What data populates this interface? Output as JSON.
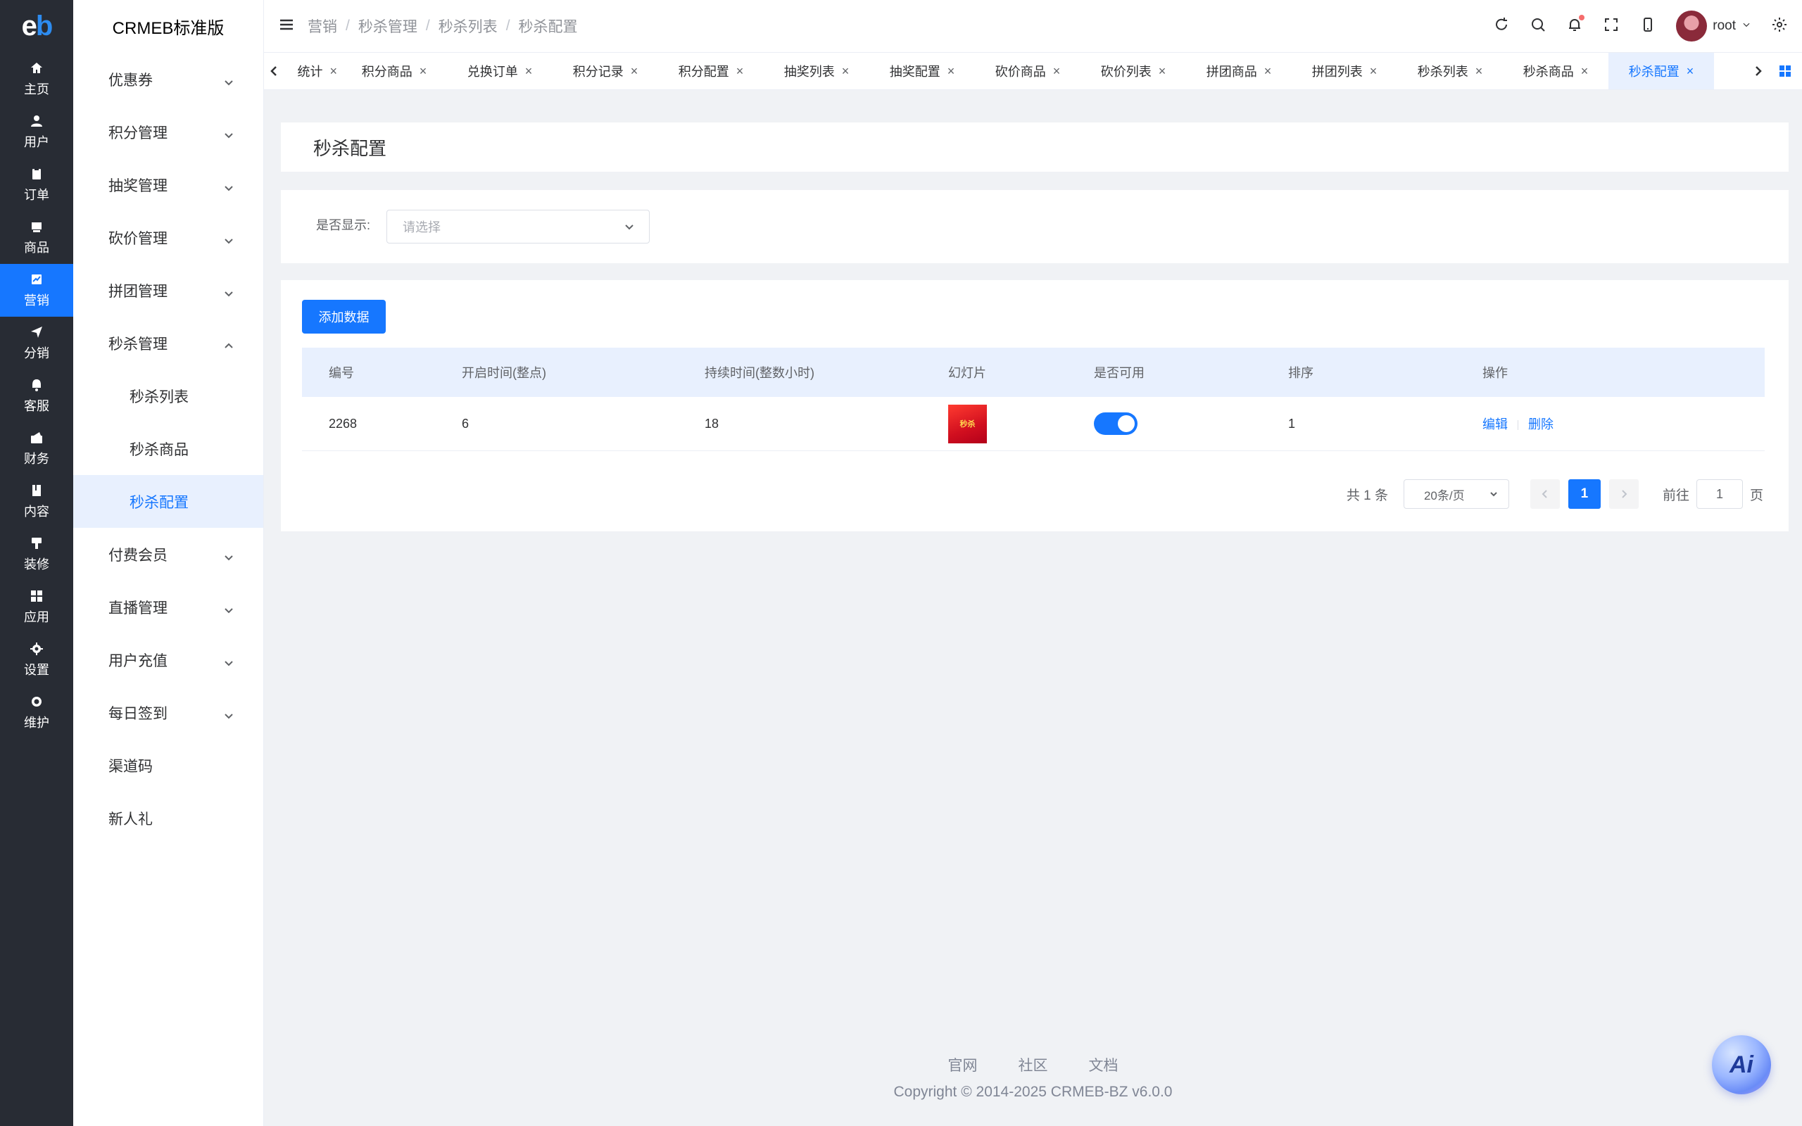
{
  "leftnav": {
    "logo_e": "e",
    "logo_b": "b",
    "items": [
      {
        "label": "主页",
        "icon": "home-icon"
      },
      {
        "label": "用户",
        "icon": "user-icon"
      },
      {
        "label": "订单",
        "icon": "order-icon"
      },
      {
        "label": "商品",
        "icon": "product-icon"
      },
      {
        "label": "营销",
        "icon": "marketing-icon"
      },
      {
        "label": "分销",
        "icon": "distribution-icon"
      },
      {
        "label": "客服",
        "icon": "service-icon"
      },
      {
        "label": "财务",
        "icon": "finance-icon"
      },
      {
        "label": "内容",
        "icon": "content-icon"
      },
      {
        "label": "装修",
        "icon": "decorate-icon"
      },
      {
        "label": "应用",
        "icon": "apps-icon"
      },
      {
        "label": "设置",
        "icon": "settings-icon"
      },
      {
        "label": "维护",
        "icon": "maintenance-icon"
      }
    ]
  },
  "sidebar": {
    "brand": "CRMEB标准版",
    "items": [
      {
        "label": "优惠券"
      },
      {
        "label": "积分管理"
      },
      {
        "label": "抽奖管理"
      },
      {
        "label": "砍价管理"
      },
      {
        "label": "拼团管理"
      },
      {
        "label": "秒杀管理"
      },
      {
        "label": "秒杀列表"
      },
      {
        "label": "秒杀商品"
      },
      {
        "label": "秒杀配置"
      },
      {
        "label": "付费会员"
      },
      {
        "label": "直播管理"
      },
      {
        "label": "用户充值"
      },
      {
        "label": "每日签到"
      },
      {
        "label": "渠道码"
      },
      {
        "label": "新人礼"
      }
    ]
  },
  "header": {
    "breadcrumb": [
      "营销",
      "秒杀管理",
      "秒杀列表",
      "秒杀配置"
    ],
    "breadcrumb_sep": "/",
    "username": "root"
  },
  "tabs": [
    {
      "label": "统计"
    },
    {
      "label": "积分商品"
    },
    {
      "label": "兑换订单"
    },
    {
      "label": "积分记录"
    },
    {
      "label": "积分配置"
    },
    {
      "label": "抽奖列表"
    },
    {
      "label": "抽奖配置"
    },
    {
      "label": "砍价商品"
    },
    {
      "label": "砍价列表"
    },
    {
      "label": "拼团商品"
    },
    {
      "label": "拼团列表"
    },
    {
      "label": "秒杀列表"
    },
    {
      "label": "秒杀商品"
    },
    {
      "label": "秒杀配置"
    }
  ],
  "tab_close": "×",
  "page": {
    "title": "秒杀配置",
    "filter_label": "是否显示:",
    "filter_placeholder": "请选择",
    "add_button": "添加数据"
  },
  "table": {
    "columns": [
      "编号",
      "开启时间(整点)",
      "持续时间(整数小时)",
      "幻灯片",
      "是否可用",
      "排序",
      "操作"
    ],
    "rows": [
      {
        "id": "2268",
        "start": "6",
        "duration": "18",
        "slide_text": "秒杀",
        "enabled": true,
        "sort": "1",
        "edit": "编辑",
        "delete": "删除"
      }
    ]
  },
  "pagination": {
    "total": "共 1 条",
    "page_size": "20条/页",
    "current": "1",
    "goto_label": "前往",
    "goto_value": "1",
    "page_unit": "页"
  },
  "footer": {
    "links": [
      "官网",
      "社区",
      "文档"
    ],
    "copyright": "Copyright © 2014-2025 CRMEB-BZ v6.0.0"
  },
  "ai_label": "Ai",
  "colors": {
    "primary": "#1677ff",
    "nav_bg": "#282c34"
  }
}
